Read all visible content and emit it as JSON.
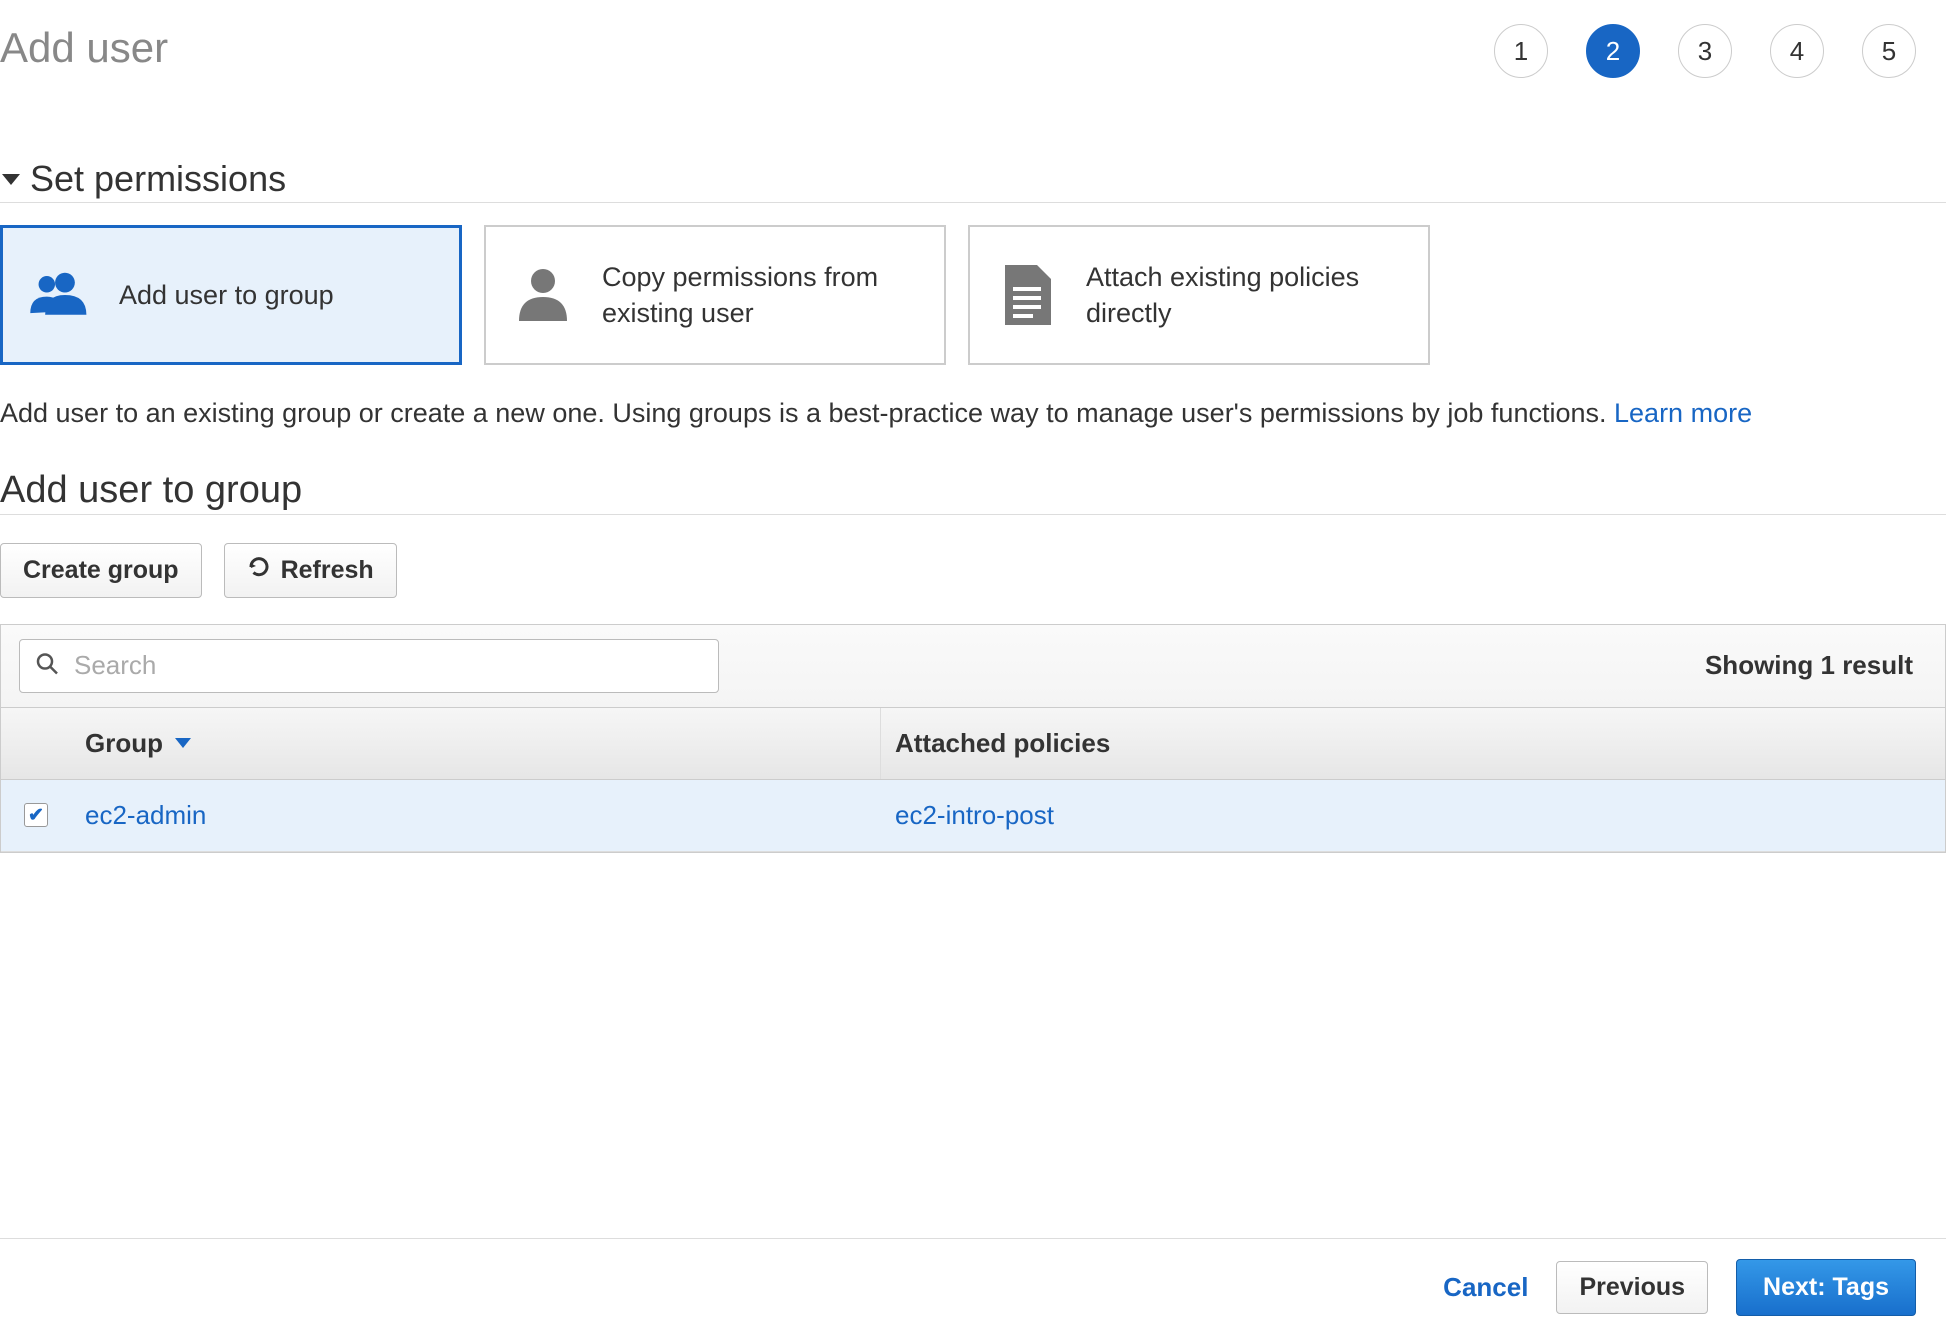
{
  "page_title": "Add user",
  "wizard": {
    "steps": [
      "1",
      "2",
      "3",
      "4",
      "5"
    ],
    "active_index": 1
  },
  "section_title": "Set permissions",
  "permission_options": [
    {
      "label": "Add user to group",
      "selected": true,
      "icon": "users-icon"
    },
    {
      "label": "Copy permissions from existing user",
      "selected": false,
      "icon": "user-icon"
    },
    {
      "label": "Attach existing policies directly",
      "selected": false,
      "icon": "document-icon"
    }
  ],
  "description_text": "Add user to an existing group or create a new one. Using groups is a best-practice way to manage user's permissions by job functions. ",
  "learn_more_label": "Learn more",
  "subtitle": "Add user to group",
  "toolbar": {
    "create_group_label": "Create group",
    "refresh_label": "Refresh"
  },
  "search": {
    "placeholder": "Search",
    "value": ""
  },
  "result_count_text": "Showing 1 result",
  "table": {
    "headers": {
      "group": "Group",
      "policies": "Attached policies"
    },
    "rows": [
      {
        "checked": true,
        "group": "ec2-admin",
        "policies": "ec2-intro-post"
      }
    ]
  },
  "footer": {
    "cancel_label": "Cancel",
    "previous_label": "Previous",
    "next_label": "Next: Tags"
  }
}
